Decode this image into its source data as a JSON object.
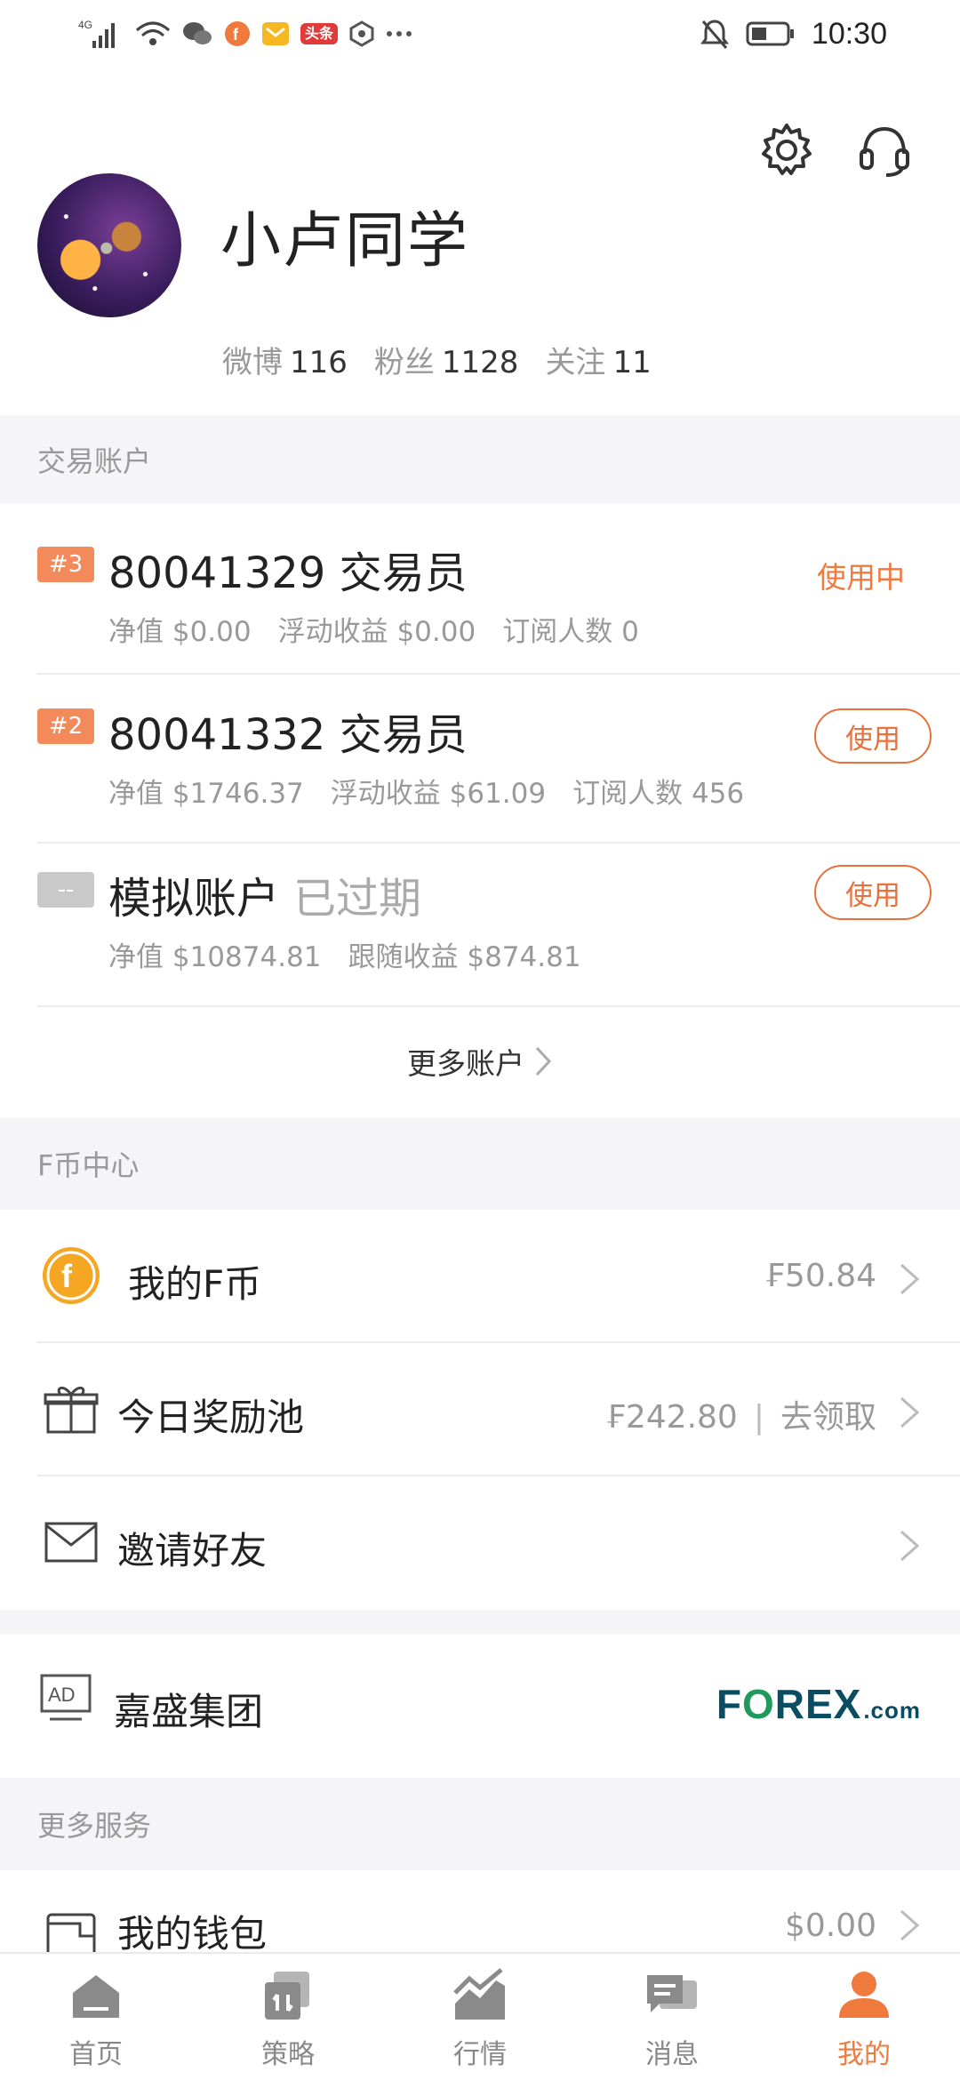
{
  "status_bar": {
    "network": "4G",
    "time": "10:30",
    "badge_toutiao": "头条"
  },
  "profile": {
    "name": "小卢同学",
    "stats": [
      {
        "label": "微博",
        "value": "116"
      },
      {
        "label": "粉丝",
        "value": "1128"
      },
      {
        "label": "关注",
        "value": "11"
      }
    ]
  },
  "accounts_section": {
    "header": "交易账户",
    "accounts": [
      {
        "tag": "#3",
        "title": "80041329 交易员",
        "expired": "",
        "sub": [
          "净值 $0.00",
          "浮动收益 $0.00",
          "订阅人数 0"
        ],
        "status": "使用中",
        "button": ""
      },
      {
        "tag": "#2",
        "title": "80041332 交易员",
        "expired": "",
        "sub": [
          "净值 $1746.37",
          "浮动收益 $61.09",
          "订阅人数 456"
        ],
        "status": "",
        "button": "使用"
      },
      {
        "tag": "--",
        "title": "模拟账户",
        "expired": "已过期",
        "sub": [
          "净值 $10874.81",
          "跟随收益 $874.81"
        ],
        "status": "",
        "button": "使用"
      }
    ],
    "more": "更多账户"
  },
  "coin_section": {
    "header": "F币中心",
    "rows": [
      {
        "label": "我的F币",
        "value": "₣50.84",
        "action": ""
      },
      {
        "label": "今日奖励池",
        "value": "₣242.80",
        "action": "去领取"
      },
      {
        "label": "邀请好友",
        "value": "",
        "action": ""
      }
    ]
  },
  "ad": {
    "badge": "AD",
    "label": "嘉盛集团",
    "logo_left": "F",
    "logo_o": "O",
    "logo_right": "REX",
    "logo_suffix": ".com"
  },
  "services_section": {
    "header": "更多服务",
    "rows": [
      {
        "label": "我的钱包",
        "value": "$0.00"
      }
    ]
  },
  "tabbar": {
    "tabs": [
      {
        "label": "首页",
        "icon": "home-icon"
      },
      {
        "label": "策略",
        "icon": "strategy-icon"
      },
      {
        "label": "行情",
        "icon": "market-chart-icon"
      },
      {
        "label": "消息",
        "icon": "message-icon"
      },
      {
        "label": "我的",
        "icon": "profile-icon",
        "active": true
      }
    ]
  },
  "colors": {
    "accent": "#f07a3e",
    "tag": "#f28a5c",
    "muted": "#999999"
  }
}
